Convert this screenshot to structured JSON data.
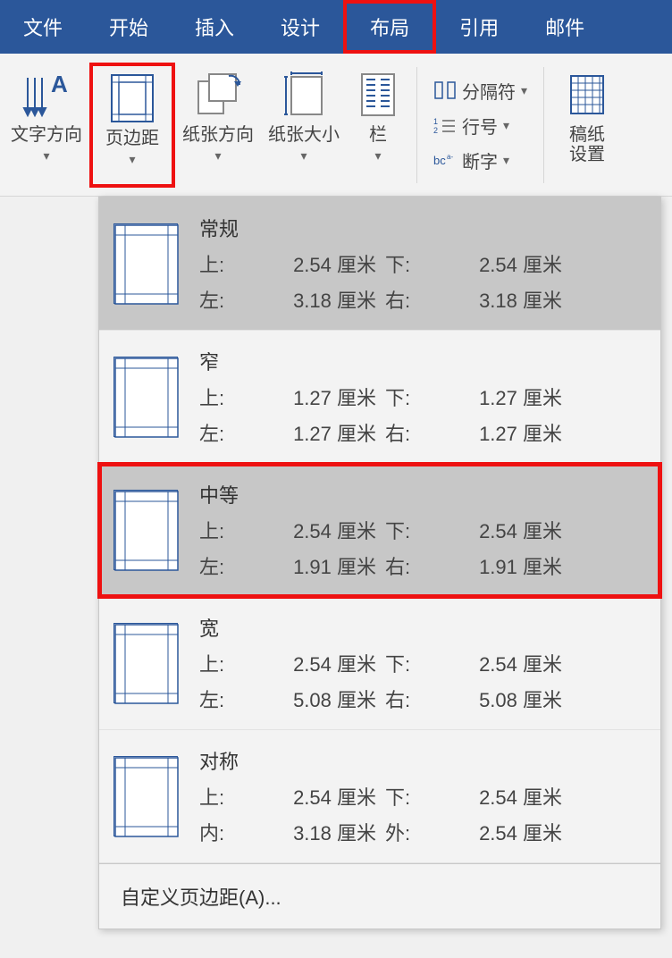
{
  "tabs": {
    "file": "文件",
    "home": "开始",
    "insert": "插入",
    "design": "设计",
    "layout": "布局",
    "references": "引用",
    "mailings": "邮件"
  },
  "ribbon": {
    "text_direction": "文字方向",
    "margins": "页边距",
    "orientation": "纸张方向",
    "size": "纸张大小",
    "columns": "栏",
    "breaks": "分隔符",
    "line_numbers": "行号",
    "hyphenation": "断字",
    "manuscript": "稿纸\n设置"
  },
  "labels": {
    "top": "上:",
    "bottom": "下:",
    "left": "左:",
    "right": "右:",
    "inside": "内:",
    "outside": "外:",
    "unit": "厘米"
  },
  "presets": [
    {
      "name": "常规",
      "top": "2.54",
      "bottom": "2.54",
      "left": "3.18",
      "right": "3.18",
      "left_label": "左:",
      "right_label": "右:",
      "selected": true,
      "highlight": false
    },
    {
      "name": "窄",
      "top": "1.27",
      "bottom": "1.27",
      "left": "1.27",
      "right": "1.27",
      "left_label": "左:",
      "right_label": "右:",
      "selected": false,
      "highlight": false
    },
    {
      "name": "中等",
      "top": "2.54",
      "bottom": "2.54",
      "left": "1.91",
      "right": "1.91",
      "left_label": "左:",
      "right_label": "右:",
      "selected": true,
      "highlight": true
    },
    {
      "name": "宽",
      "top": "2.54",
      "bottom": "2.54",
      "left": "5.08",
      "right": "5.08",
      "left_label": "左:",
      "right_label": "右:",
      "selected": false,
      "highlight": false
    },
    {
      "name": "对称",
      "top": "2.54",
      "bottom": "2.54",
      "left": "3.18",
      "right": "2.54",
      "left_label": "内:",
      "right_label": "外:",
      "selected": false,
      "highlight": false
    }
  ],
  "custom_margins": "自定义页边距(A)..."
}
